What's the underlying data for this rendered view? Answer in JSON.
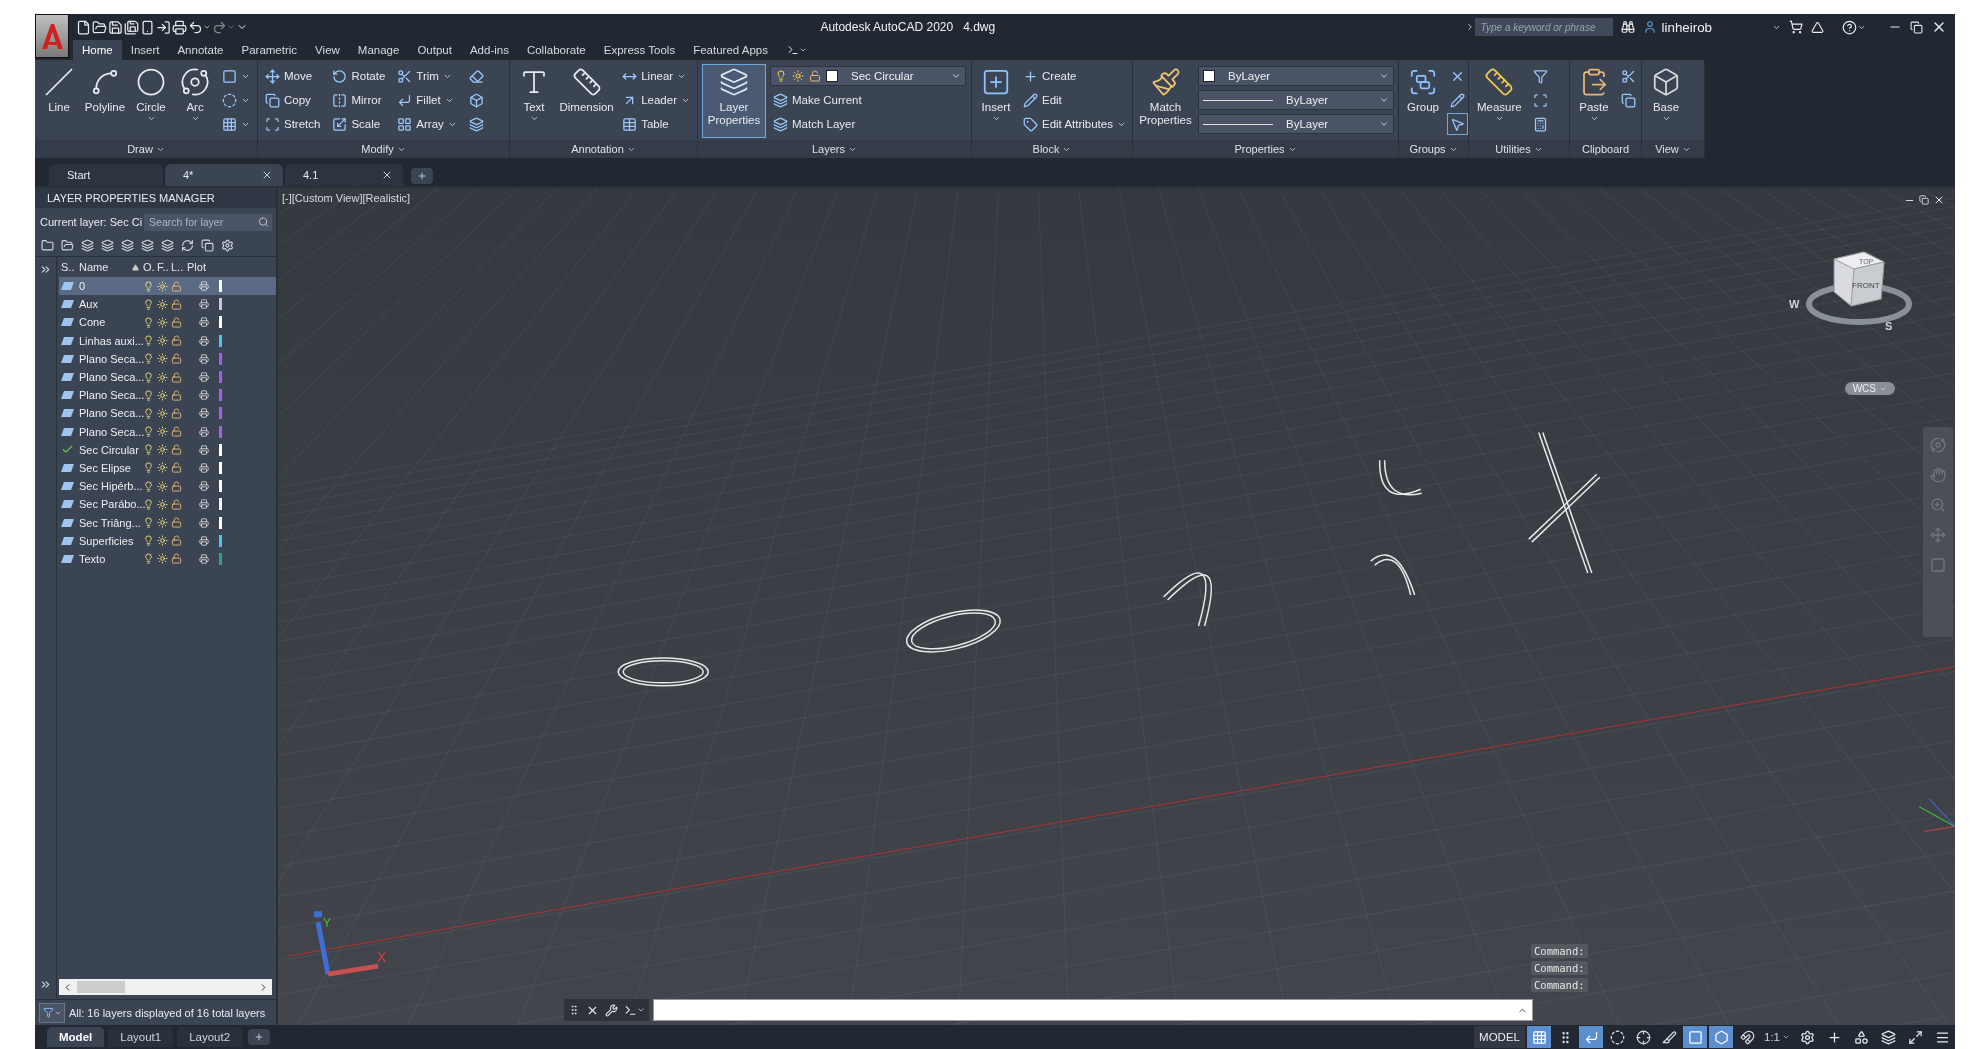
{
  "title_bar": {
    "app_title": "Autodesk AutoCAD 2020",
    "file_name": "4.dwg",
    "search": {
      "placeholder": "Type a keyword or phrase"
    },
    "user": "linheirob"
  },
  "ribbon_tabs": [
    {
      "label": "Home",
      "selected": true
    },
    {
      "label": "Insert",
      "selected": false
    },
    {
      "label": "Annotate",
      "selected": false
    },
    {
      "label": "Parametric",
      "selected": false
    },
    {
      "label": "View",
      "selected": false
    },
    {
      "label": "Manage",
      "selected": false
    },
    {
      "label": "Output",
      "selected": false
    },
    {
      "label": "Add-ins",
      "selected": false
    },
    {
      "label": "Collaborate",
      "selected": false
    },
    {
      "label": "Express Tools",
      "selected": false
    },
    {
      "label": "Featured Apps",
      "selected": false
    }
  ],
  "ribbon_panels": [
    {
      "title": "Draw",
      "menu": true,
      "tools": [
        {
          "kind": "large",
          "label": "Line",
          "dropdown": false
        },
        {
          "kind": "large",
          "label": "Polyline",
          "dropdown": false
        },
        {
          "kind": "large",
          "label": "Circle",
          "dropdown": true
        },
        {
          "kind": "large",
          "label": "Arc",
          "dropdown": true
        },
        {
          "kind": "icon",
          "dropdown": true
        },
        {
          "kind": "icon",
          "dropdown": true
        },
        {
          "kind": "icon",
          "dropdown": true
        }
      ]
    },
    {
      "title": "Modify",
      "menu": true,
      "tools": [
        {
          "kind": "small",
          "label": "Move",
          "dropdown": false
        },
        {
          "kind": "small",
          "label": "Copy",
          "dropdown": false
        },
        {
          "kind": "small",
          "label": "Stretch",
          "dropdown": false
        },
        {
          "kind": "small",
          "label": "Rotate",
          "dropdown": false
        },
        {
          "kind": "small",
          "label": "Mirror",
          "dropdown": false
        },
        {
          "kind": "small",
          "label": "Scale",
          "dropdown": false
        },
        {
          "kind": "small",
          "label": "Trim",
          "dropdown": true
        },
        {
          "kind": "small",
          "label": "Fillet",
          "dropdown": true
        },
        {
          "kind": "small",
          "label": "Array",
          "dropdown": true
        },
        {
          "kind": "icon",
          "dropdown": false
        },
        {
          "kind": "icon",
          "dropdown": false
        },
        {
          "kind": "icon",
          "dropdown": false
        }
      ]
    },
    {
      "title": "Annotation",
      "menu": true,
      "tools": [
        {
          "kind": "large",
          "label": "Text",
          "dropdown": true
        },
        {
          "kind": "large",
          "label": "Dimension",
          "dropdown": false
        },
        {
          "kind": "small",
          "label": "Linear",
          "dropdown": true
        },
        {
          "kind": "small",
          "label": "Leader",
          "dropdown": true
        },
        {
          "kind": "small",
          "label": "Table",
          "dropdown": false
        }
      ]
    },
    {
      "title": "Layers",
      "menu": true,
      "tools": [
        {
          "kind": "large",
          "label": "Layer Properties",
          "dropdown": false,
          "active": true
        },
        {
          "kind": "layercombo",
          "value": "Sec Circular"
        },
        {
          "kind": "small",
          "label": "Make Current",
          "dropdown": false
        },
        {
          "kind": "small",
          "label": "Match Layer",
          "dropdown": false
        }
      ]
    },
    {
      "title": "Block",
      "menu": true,
      "tools": [
        {
          "kind": "large",
          "label": "Insert",
          "dropdown": true
        },
        {
          "kind": "small",
          "label": "Create",
          "dropdown": false
        },
        {
          "kind": "small",
          "label": "Edit",
          "dropdown": false
        },
        {
          "kind": "small",
          "label": "Edit Attributes",
          "dropdown": true
        }
      ]
    },
    {
      "title": "Properties",
      "menu": true,
      "tools": [
        {
          "kind": "large",
          "label": "Match Properties",
          "dropdown": false
        },
        {
          "kind": "colorcombo",
          "value": "ByLayer"
        },
        {
          "kind": "linecombo",
          "value": "ByLayer"
        },
        {
          "kind": "linecombo",
          "value": "ByLayer"
        }
      ]
    },
    {
      "title": "Groups",
      "menu": true,
      "tools": [
        {
          "kind": "large",
          "label": "Group",
          "dropdown": false
        },
        {
          "kind": "icon",
          "dropdown": false
        },
        {
          "kind": "icon",
          "dropdown": false
        },
        {
          "kind": "icon",
          "dropdown": false,
          "active": true
        }
      ]
    },
    {
      "title": "Utilities",
      "menu": true,
      "tools": [
        {
          "kind": "large",
          "label": "Measure",
          "dropdown": true
        },
        {
          "kind": "icon",
          "dropdown": false
        },
        {
          "kind": "icon",
          "dropdown": false
        },
        {
          "kind": "icon",
          "dropdown": false
        }
      ]
    },
    {
      "title": "Clipboard",
      "menu": false,
      "tools": [
        {
          "kind": "large",
          "label": "Paste",
          "dropdown": true
        },
        {
          "kind": "icon",
          "dropdown": false
        },
        {
          "kind": "icon",
          "dropdown": false
        }
      ]
    },
    {
      "title": "View",
      "menu": true,
      "tools": [
        {
          "kind": "large",
          "label": "Base",
          "dropdown": true
        }
      ]
    }
  ],
  "document_tabs": [
    {
      "label": "Start",
      "selected": false,
      "closable": false
    },
    {
      "label": "4*",
      "selected": true,
      "closable": true
    },
    {
      "label": "4.1",
      "selected": false,
      "closable": true
    }
  ],
  "layer_manager": {
    "title": "LAYER PROPERTIES MANAGER",
    "current_layer": "Current layer: Sec Ci",
    "search": {
      "placeholder": "Search for layer"
    },
    "columns": [
      "S..",
      "Name",
      "O.",
      "F..",
      "L..",
      "Plot"
    ],
    "rows": [
      {
        "name": "0",
        "current": false,
        "selected": true,
        "color": "#ffffff"
      },
      {
        "name": "Aux",
        "current": false,
        "selected": false,
        "color": "#c8c8c8"
      },
      {
        "name": "Cone",
        "current": false,
        "selected": false,
        "color": "#ffffff"
      },
      {
        "name": "Linhas auxi...",
        "current": false,
        "selected": false,
        "color": "#4fc3e8"
      },
      {
        "name": "Plano Seca...",
        "current": false,
        "selected": false,
        "color": "#a45ee8"
      },
      {
        "name": "Plano Seca...",
        "current": false,
        "selected": false,
        "color": "#a45ee8"
      },
      {
        "name": "Plano Seca...",
        "current": false,
        "selected": false,
        "color": "#a45ee8"
      },
      {
        "name": "Plano Seca...",
        "current": false,
        "selected": false,
        "color": "#a45ee8"
      },
      {
        "name": "Plano Seca...",
        "current": false,
        "selected": false,
        "color": "#a45ee8"
      },
      {
        "name": "Sec Circular",
        "current": true,
        "selected": false,
        "color": "#ffffff"
      },
      {
        "name": "Sec Elipse",
        "current": false,
        "selected": false,
        "color": "#ffffff"
      },
      {
        "name": "Sec Hipérb...",
        "current": false,
        "selected": false,
        "color": "#ffffff"
      },
      {
        "name": "Sec Parábo...",
        "current": false,
        "selected": false,
        "color": "#ffffff"
      },
      {
        "name": "Sec Triâng...",
        "current": false,
        "selected": false,
        "color": "#ffffff"
      },
      {
        "name": "Superficies",
        "current": false,
        "selected": false,
        "color": "#4fc3e8"
      },
      {
        "name": "Texto",
        "current": false,
        "selected": false,
        "color": "#2aa198"
      }
    ],
    "status": "All: 16 layers displayed of 16 total layers"
  },
  "viewport": {
    "label": "[-][Custom View][Realistic]",
    "viewcube": {
      "front": "FRONT",
      "top": "TOP",
      "west": "W",
      "south": "S",
      "ucs": "WCS"
    },
    "ucs_icon": {
      "x": "X",
      "y": "Y"
    },
    "command_history": [
      "Command:",
      "Command:",
      "Command:"
    ]
  },
  "layout_tabs": [
    {
      "label": "Model",
      "selected": true
    },
    {
      "label": "Layout1",
      "selected": false
    },
    {
      "label": "Layout2",
      "selected": false
    }
  ],
  "status_bar": {
    "space": "MODEL",
    "scale": "1:1",
    "toggles": [
      {
        "on": true
      },
      {
        "on": false
      },
      {
        "on": true
      },
      {
        "on": false
      },
      {
        "on": false
      },
      {
        "on": false
      },
      {
        "on": true
      },
      {
        "on": true
      },
      {
        "on": false
      }
    ]
  }
}
